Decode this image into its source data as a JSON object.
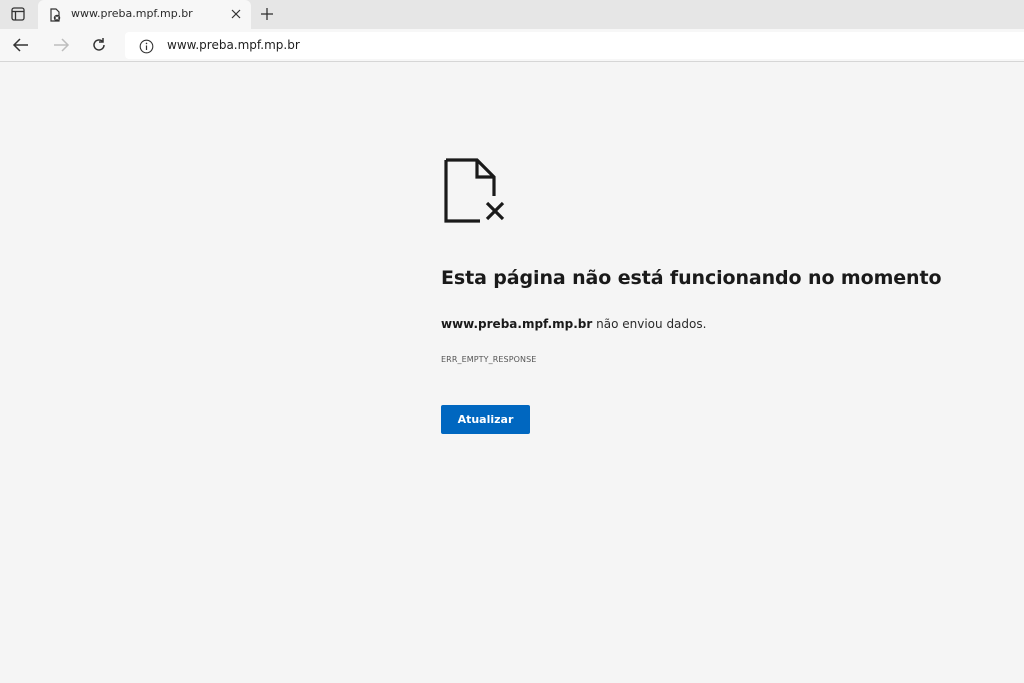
{
  "browser": {
    "tab": {
      "title": "www.preba.mpf.mp.br",
      "favicon": "page-error-icon",
      "close_icon": "close-icon"
    },
    "tab_actions_icon": "tab-actions-icon",
    "new_tab_icon": "plus-icon",
    "toolbar": {
      "back_icon": "back-arrow-icon",
      "forward_icon": "forward-arrow-icon",
      "reload_icon": "reload-icon",
      "site_info_icon": "info-icon",
      "url": "www.preba.mpf.mp.br"
    }
  },
  "error_page": {
    "icon": "broken-page-icon",
    "title": "Esta página não está funcionando no momento",
    "description_host": "www.preba.mpf.mp.br",
    "description_rest": " não enviou dados.",
    "error_code": "ERR_EMPTY_RESPONSE",
    "reload_label": "Atualizar"
  },
  "colors": {
    "page_background": "#f5f5f5",
    "button_primary": "#0067c0",
    "tabstrip": "#e6e6e6"
  }
}
